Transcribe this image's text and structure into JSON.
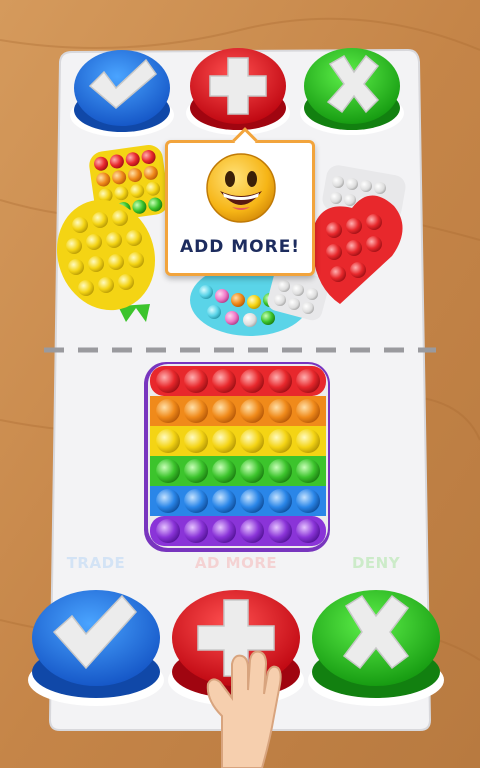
{
  "prompt": {
    "text": "ADD MORE!",
    "emoji_icon": "grinning-emoji-icon"
  },
  "top_buttons": [
    {
      "name": "accept-button-top",
      "icon": "check-icon",
      "color": "#2e7fe0"
    },
    {
      "name": "add-more-button-top",
      "icon": "plus-icon",
      "color": "#e0202a"
    },
    {
      "name": "deny-button-top",
      "icon": "x-icon",
      "color": "#2ebf2c"
    }
  ],
  "bottom_buttons": [
    {
      "label": "TRADE",
      "icon": "check-icon",
      "color": "#2e7fe0",
      "label_color": "#b9d6f5"
    },
    {
      "label": "AD MORE",
      "icon": "plus-icon",
      "color": "#e0202a",
      "label_color": "#f5b8b8"
    },
    {
      "label": "DENY",
      "icon": "x-icon",
      "color": "#2ebf2c",
      "label_color": "#aee6a6"
    }
  ],
  "colors": {
    "table": "#c98a4e",
    "board": "#f2f2f4",
    "divider": "#9a9a9e"
  }
}
